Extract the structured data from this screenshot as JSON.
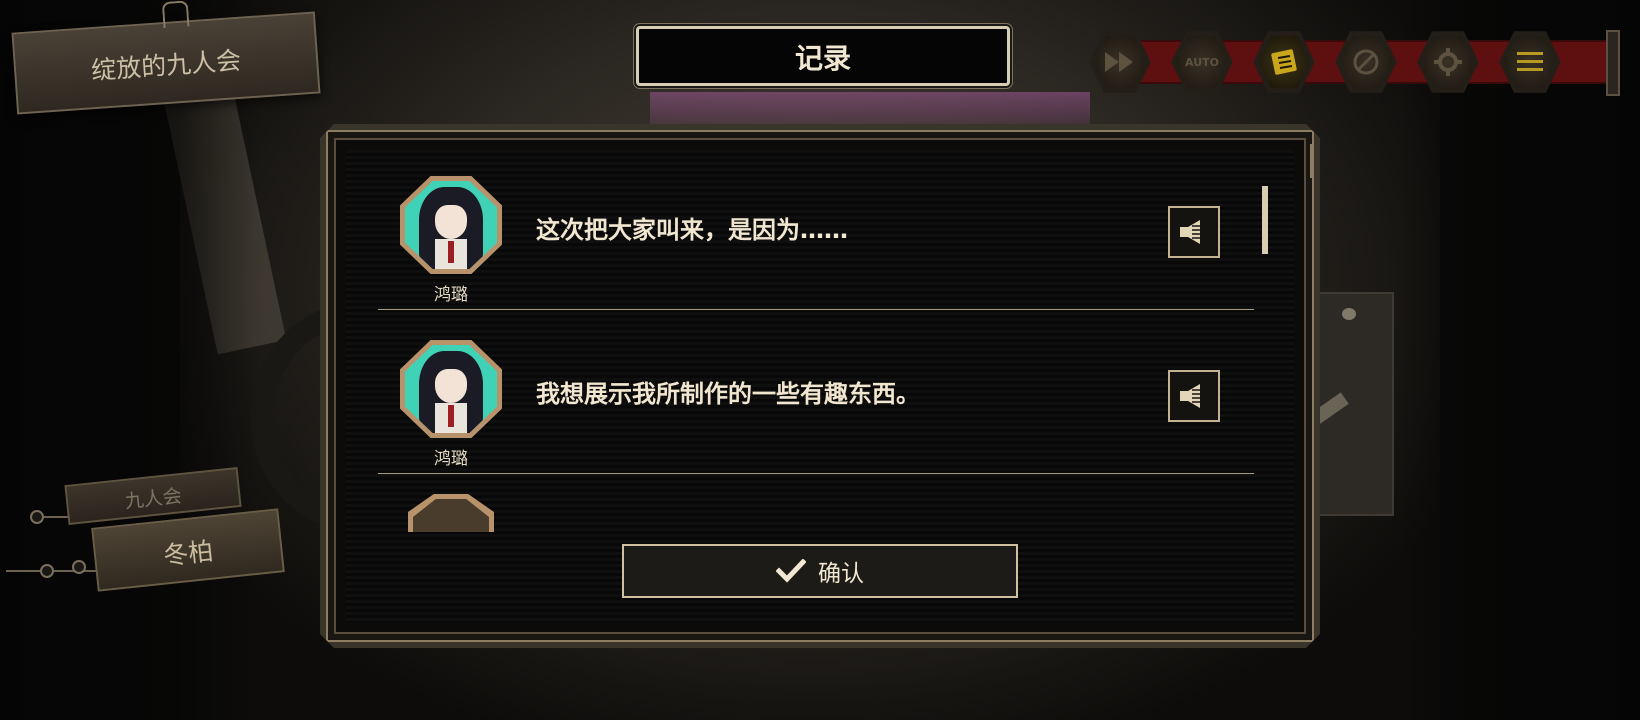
{
  "scene": {
    "chapter_title": "绽放的九人会",
    "side_tag_small": "九人会",
    "side_tag_main": "冬柏"
  },
  "dialog": {
    "title": "记录",
    "entries": [
      {
        "speaker": "鸿璐",
        "text": "这次把大家叫来，是因为……",
        "avatar": "honglu-portrait",
        "voice_icon": "speaker-icon"
      },
      {
        "speaker": "鸿璐",
        "text": "我想展示我所制作的一些有趣东西。",
        "avatar": "honglu-portrait",
        "voice_icon": "speaker-icon"
      }
    ],
    "confirm_label": "确认",
    "confirm_icon": "check-icon"
  },
  "toolbar": {
    "buttons": [
      {
        "name": "fast-forward",
        "icon": "fast-forward-icon",
        "active": false
      },
      {
        "name": "auto",
        "icon": "auto-icon",
        "label": "AUTO",
        "active": false
      },
      {
        "name": "log",
        "icon": "log-icon",
        "active": true
      },
      {
        "name": "hide-ui",
        "icon": "hide-icon",
        "active": false
      },
      {
        "name": "settings",
        "icon": "gear-icon",
        "active": false
      },
      {
        "name": "menu",
        "icon": "menu-icon",
        "active": false
      }
    ]
  },
  "colors": {
    "accent_gold": "#c9a61c",
    "frame_tan": "#c2b392",
    "avatar_bg": "#3fd2b6",
    "rail_red": "#5e1010"
  }
}
